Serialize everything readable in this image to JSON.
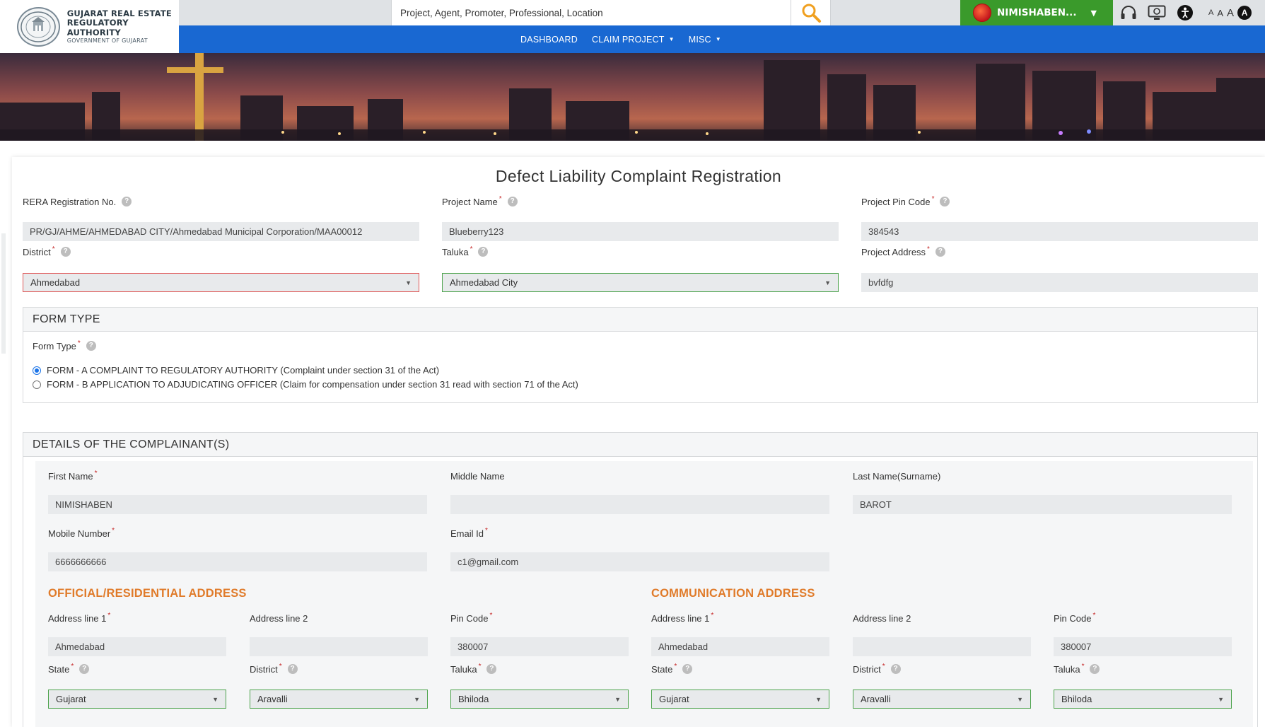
{
  "logo": {
    "line1": "GUJARAT REAL ESTATE",
    "line2": "REGULATORY AUTHORITY",
    "line3": "GOVERNMENT OF GUJARAT"
  },
  "search": {
    "placeholder": "Project, Agent, Promoter, Professional, Location"
  },
  "user": {
    "name": "NIMISHABEN..."
  },
  "font_controls": [
    "A",
    "A",
    "A",
    "A"
  ],
  "nav": [
    {
      "label": "DASHBOARD",
      "dropdown": false
    },
    {
      "label": "CLAIM PROJECT",
      "dropdown": true
    },
    {
      "label": "MISC",
      "dropdown": true
    }
  ],
  "page_title": "Defect Liability Complaint Registration",
  "project": {
    "rera_label": "RERA Registration No.",
    "rera_value": "PR/GJ/AHME/AHMEDABAD CITY/Ahmedabad Municipal Corporation/MAA00012",
    "name_label": "Project Name",
    "name_value": "Blueberry123",
    "pin_label": "Project Pin Code",
    "pin_value": "384543",
    "district_label": "District",
    "district_value": "Ahmedabad",
    "taluka_label": "Taluka",
    "taluka_value": "Ahmedabad City",
    "address_label": "Project Address",
    "address_value": "bvfdfg"
  },
  "form_type": {
    "heading": "FORM TYPE",
    "label": "Form Type",
    "options": [
      {
        "text": "FORM - A COMPLAINT TO REGULATORY AUTHORITY (Complaint under section 31 of the Act)",
        "selected": true
      },
      {
        "text": "FORM - B APPLICATION TO ADJUDICATING OFFICER (Claim for compensation under section 31 read with section 71 of the Act)",
        "selected": false
      }
    ]
  },
  "complainant": {
    "heading": "DETAILS OF THE COMPLAINANT(S)",
    "first_name_label": "First Name",
    "first_name": "NIMISHABEN",
    "middle_name_label": "Middle Name",
    "middle_name": "",
    "last_name_label": "Last Name(Surname)",
    "last_name": "BAROT",
    "mobile_label": "Mobile Number",
    "mobile": "6666666666",
    "email_label": "Email Id",
    "email": "c1@gmail.com"
  },
  "official_address": {
    "heading": "OFFICIAL/RESIDENTIAL ADDRESS",
    "line1_label": "Address line 1",
    "line1": "Ahmedabad",
    "line2_label": "Address line 2",
    "line2": "",
    "pin_label": "Pin Code",
    "pin": "380007",
    "state_label": "State",
    "state": "Gujarat",
    "district_label": "District",
    "district": "Aravalli",
    "taluka_label": "Taluka",
    "taluka": "Bhiloda"
  },
  "communication_address": {
    "heading": "COMMUNICATION ADDRESS",
    "line1_label": "Address line 1",
    "line1": "Ahmedabad",
    "line2_label": "Address line 2",
    "line2": "",
    "pin_label": "Pin Code",
    "pin": "380007",
    "state_label": "State",
    "state": "Gujarat",
    "district_label": "District",
    "district": "Aravalli",
    "taluka_label": "Taluka",
    "taluka": "Bhiloda"
  },
  "colors": {
    "nav_blue": "#1968d2",
    "user_green": "#3a9a2b",
    "accent_orange": "#e07b2a",
    "error_red": "#e05a5a",
    "valid_green": "#4ca34c"
  },
  "icons": {
    "search": "magnifier-icon",
    "help": "question-circle-icon",
    "headphones": "headphones-icon",
    "screen_reader": "screen-reader-icon",
    "sign_language": "accessibility-icon"
  }
}
